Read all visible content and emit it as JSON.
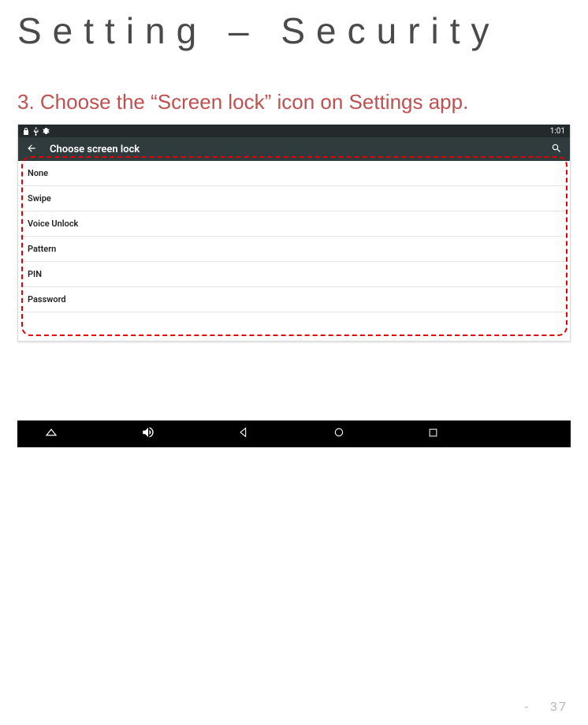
{
  "title": "Setting – Security",
  "instruction": "3. Choose the “Screen lock” icon on Settings app.",
  "statusbar": {
    "clock": "1:01"
  },
  "appbar": {
    "title": "Choose screen lock"
  },
  "options": [
    "None",
    "Swipe",
    "Voice Unlock",
    "Pattern",
    "PIN",
    "Password"
  ],
  "footer": {
    "dash": "-",
    "page": "37"
  }
}
